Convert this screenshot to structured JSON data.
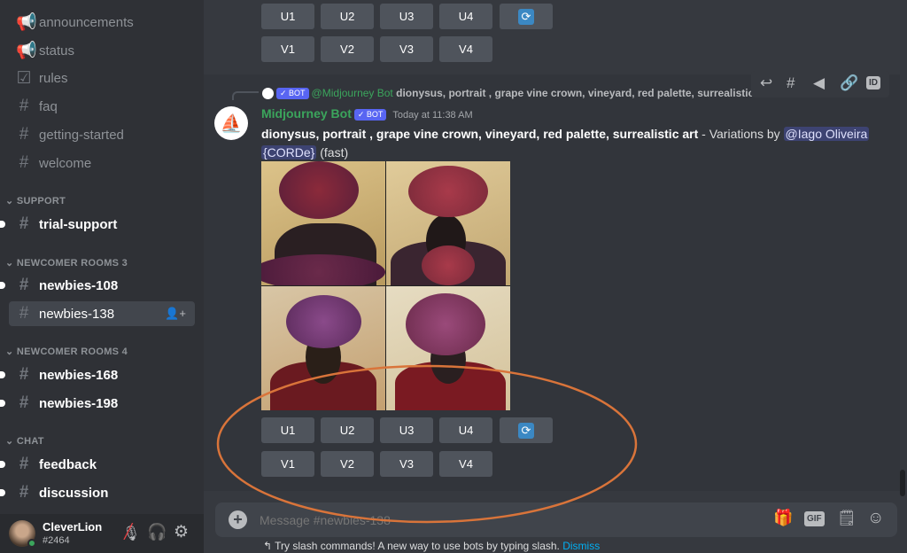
{
  "sidebar": {
    "channels_top": [
      {
        "icon": "megaphone-icon",
        "label": "announcements"
      },
      {
        "icon": "megaphone-icon",
        "label": "status"
      },
      {
        "icon": "rules-icon",
        "label": "rules"
      },
      {
        "icon": "hash-icon",
        "label": "faq"
      },
      {
        "icon": "hash-icon",
        "label": "getting-started"
      },
      {
        "icon": "hash-icon",
        "label": "welcome"
      }
    ],
    "support": {
      "title": "SUPPORT",
      "items": [
        {
          "label": "trial-support"
        }
      ]
    },
    "newcomer3": {
      "title": "NEWCOMER ROOMS 3",
      "items": [
        {
          "label": "newbies-108"
        },
        {
          "label": "newbies-138"
        }
      ]
    },
    "newcomer4": {
      "title": "NEWCOMER ROOMS 4",
      "items": [
        {
          "label": "newbies-168"
        },
        {
          "label": "newbies-198"
        }
      ]
    },
    "chat": {
      "title": "CHAT",
      "items": [
        {
          "label": "feedback"
        },
        {
          "label": "discussion"
        }
      ]
    }
  },
  "user": {
    "name": "CleverLion",
    "tag": "#2464",
    "status_color": "#3ba55c"
  },
  "buttons": {
    "u": [
      "U1",
      "U2",
      "U3",
      "U4"
    ],
    "v": [
      "V1",
      "V2",
      "V3",
      "V4"
    ],
    "reroll_icon": "refresh-icon"
  },
  "message": {
    "reply_author": "@Midjourney Bot",
    "reply_text": "dionysus, portrait , grape vine crown, vineyard, red palette, surrealistic art - Variations b...",
    "bot_badge": "✓ BOT",
    "author": "Midjourney Bot",
    "author_color": "#3ba55c",
    "timestamp": "Today at 11:38 AM",
    "prompt": "dionysus, portrait , grape vine crown, vineyard, red palette, surrealistic art",
    "variations_by": " - Variations by ",
    "mention": "@Iago Oliveira",
    "mention2": "{CORDe}",
    "speed": "(fast)"
  },
  "toolbar": [
    "reply-icon",
    "thread-icon",
    "pin-icon",
    "link-icon",
    "id-icon"
  ],
  "composer": {
    "placeholder": "Message #newbies-138",
    "gift": "gift-icon",
    "gif": "GIF",
    "sticker": "sticker-icon",
    "emoji": "emoji-icon"
  },
  "hint": {
    "text": "Try slash commands! A new way to use bots by typing slash.",
    "dismiss": "Dismiss",
    "link_color": "#00b0f4"
  },
  "annotation_color": "#d9743a"
}
